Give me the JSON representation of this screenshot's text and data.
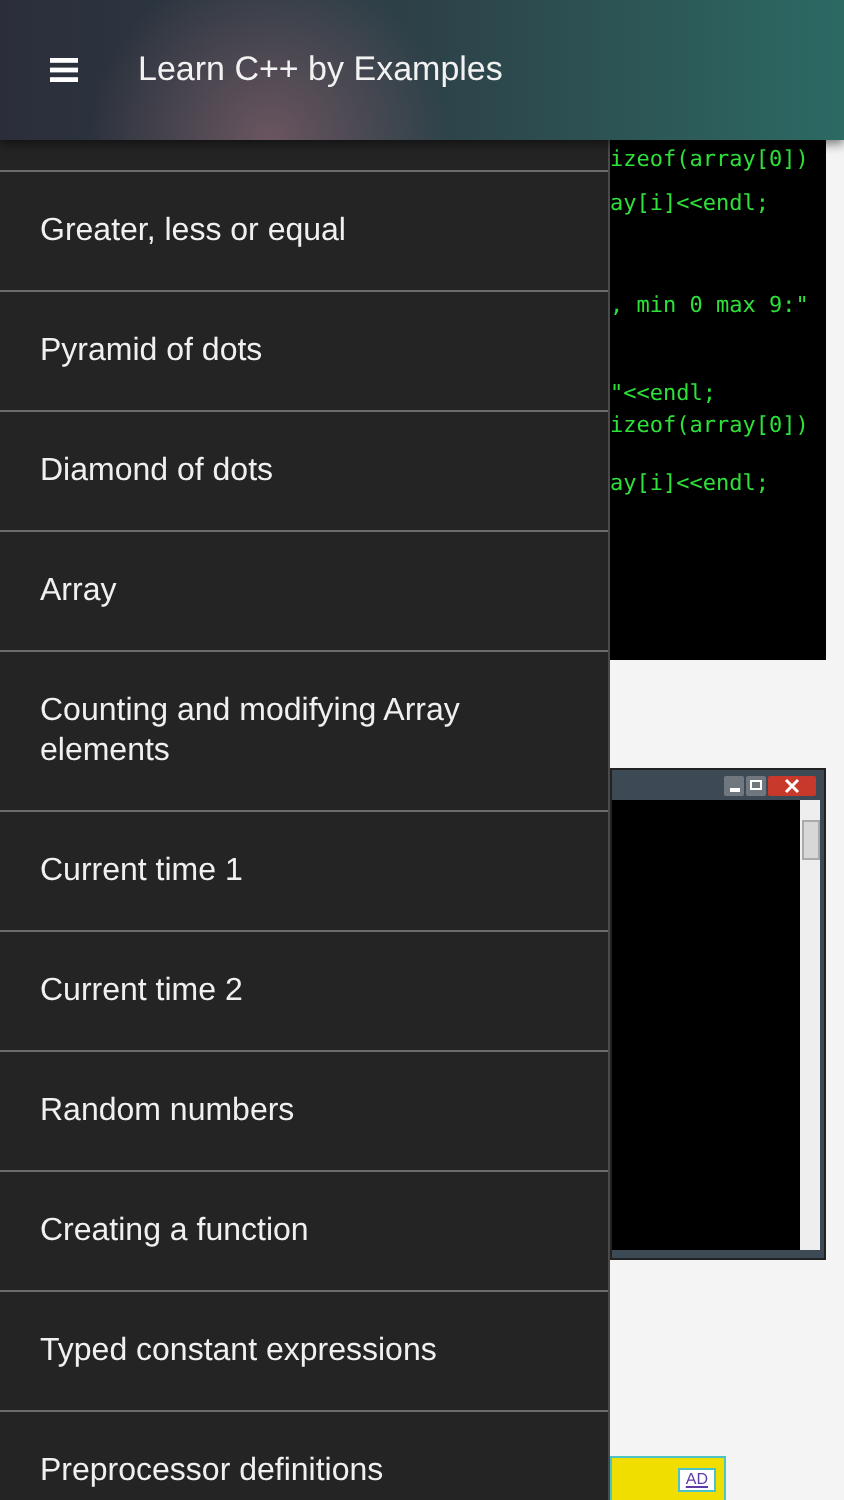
{
  "app_bar": {
    "title": "Learn C++ by Examples"
  },
  "drawer": {
    "items": [
      {
        "label": "Greater, less or equal"
      },
      {
        "label": "Pyramid of dots"
      },
      {
        "label": "Diamond of dots"
      },
      {
        "label": "Array"
      },
      {
        "label": "Counting and modifying Array elements"
      },
      {
        "label": "Current time 1"
      },
      {
        "label": "Current time 2"
      },
      {
        "label": "Random numbers"
      },
      {
        "label": "Creating a function"
      },
      {
        "label": "Typed constant expressions"
      },
      {
        "label": "Preprocessor definitions"
      }
    ]
  },
  "background": {
    "code_blocks": [
      [
        "izeof(array[0])"
      ],
      [
        "ay[i]<<endl;"
      ],
      [
        ", min 0 max 9:\""
      ],
      [
        "\"<<endl;",
        "izeof(array[0])"
      ],
      [
        "ay[i]<<endl;"
      ]
    ],
    "ad": {
      "label": "AD"
    }
  }
}
